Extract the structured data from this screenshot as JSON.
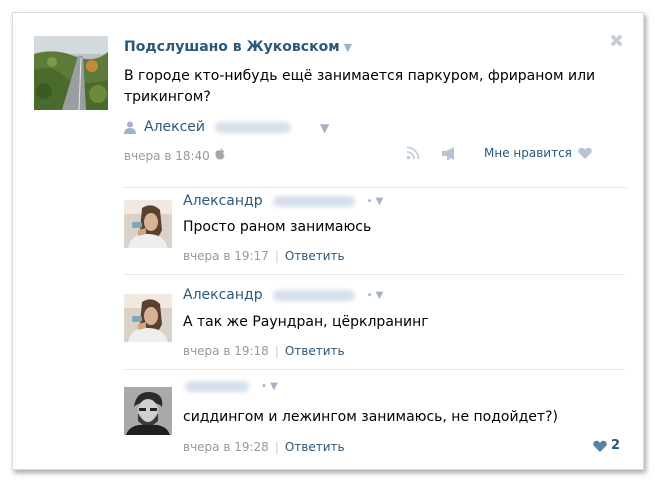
{
  "post": {
    "group_name": "Подслушано в Жуковском",
    "group_caret_icon": "chevron-down-icon",
    "close_icon": "close-icon",
    "text": "В городе кто-нибудь ещё занимается паркуром, фрираном или трикингом?",
    "author_first_name": "Алексей",
    "time": "вчера в 18:40",
    "like_label": "Мне нравится"
  },
  "comments": [
    {
      "author": "Александр",
      "text": "Просто раном занимаюсь",
      "time": "вчера в 19:17",
      "reply_label": "Ответить"
    },
    {
      "author": "Александр",
      "text": "А так же Раундран, цёрклранинг",
      "time": "вчера в 19:18",
      "reply_label": "Ответить"
    },
    {
      "author": "",
      "text": "сиддингом и лежингом занимаюсь, не подойдет?)",
      "time": "вчера в 19:28",
      "reply_label": "Ответить",
      "likes": "2"
    }
  ],
  "colors": {
    "link": "#2b587a",
    "meta": "#999999",
    "icon": "#b6c4d4"
  }
}
